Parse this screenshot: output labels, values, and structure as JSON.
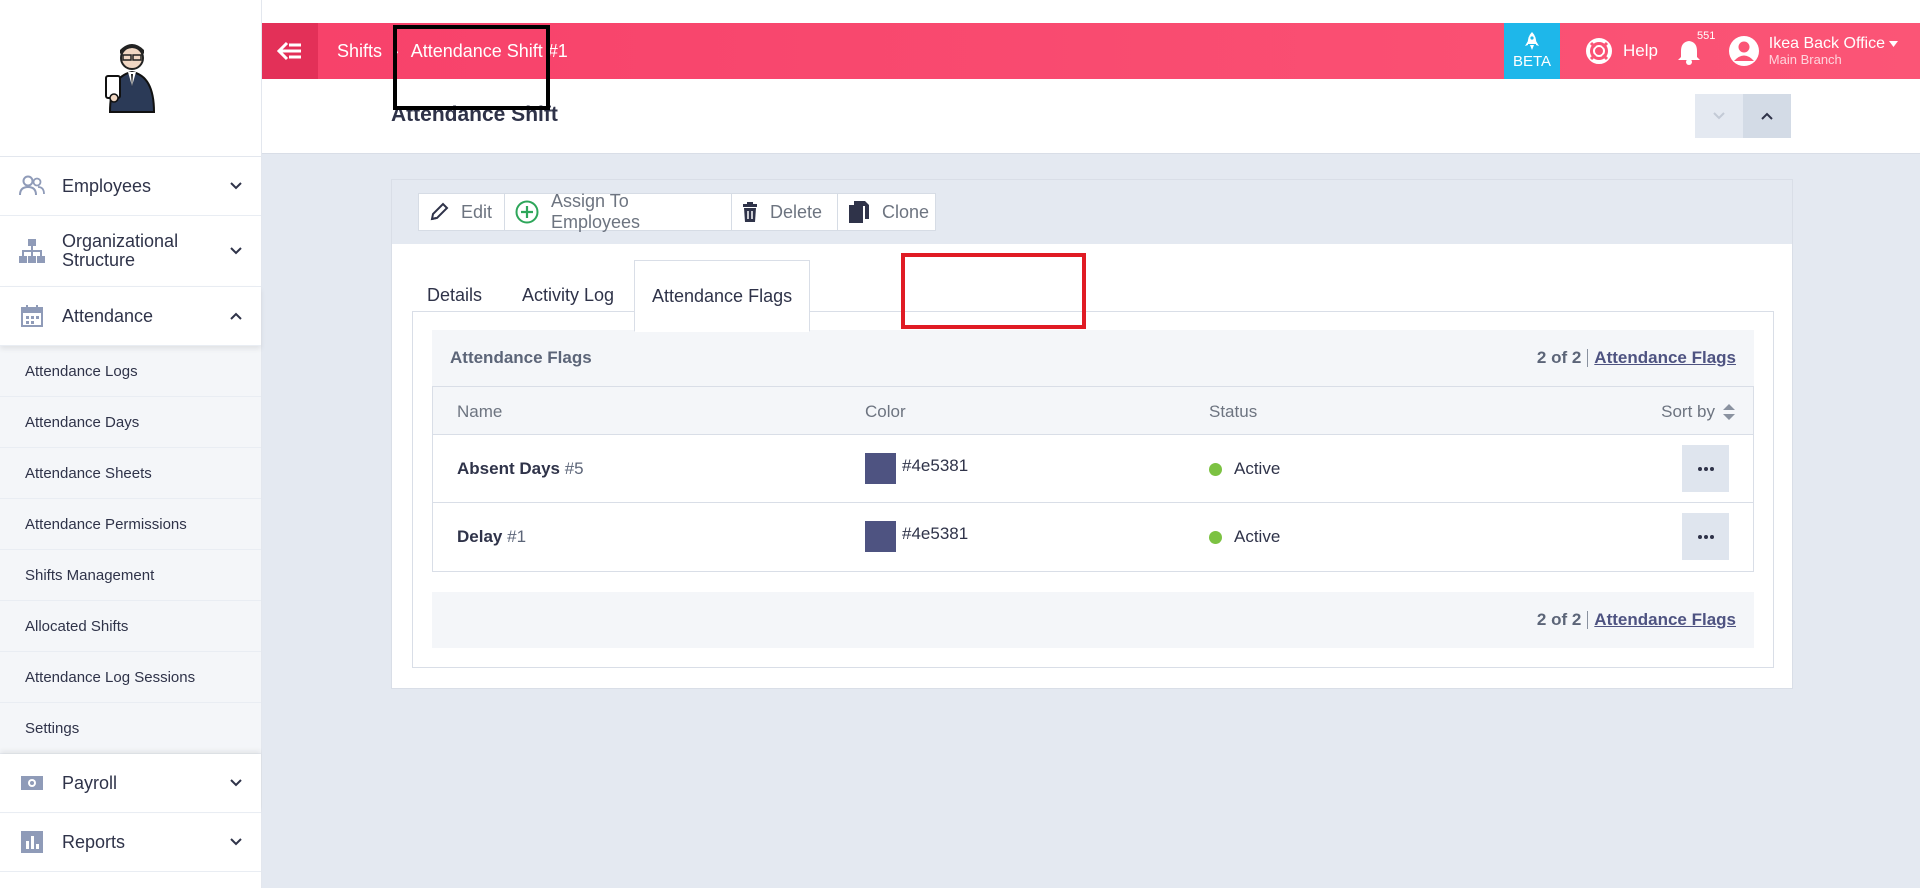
{
  "sidebar": {
    "groups": [
      {
        "label": "Employees",
        "icon": "people-icon",
        "expanded": false
      },
      {
        "label": "Organizational\nStructure",
        "icon": "org-chart-icon",
        "expanded": false
      },
      {
        "label": "Attendance",
        "icon": "calendar-icon",
        "expanded": true
      },
      {
        "label": "Payroll",
        "icon": "money-icon",
        "expanded": false
      },
      {
        "label": "Reports",
        "icon": "bar-chart-icon",
        "expanded": false
      }
    ],
    "attendance_items": [
      "Attendance Logs",
      "Attendance Days",
      "Attendance Sheets",
      "Attendance Permissions",
      "Shifts Management",
      "Allocated Shifts",
      "Attendance Log Sessions",
      "Settings"
    ],
    "icon_color": "#8f9bb8"
  },
  "topbar": {
    "crumb_parent": "Shifts",
    "crumb_current": "Attendance Shift #1",
    "beta_label": "BETA",
    "help_label": "Help",
    "notification_count": "551",
    "user_name": "Ikea Back Office",
    "user_branch": "Main Branch",
    "gradient_start": "#f7416a",
    "gradient_end": "#fb5576",
    "beta_color": "#1eb7ea"
  },
  "page": {
    "title": "Attendance Shift"
  },
  "toolbar": {
    "edit_label": "Edit",
    "assign_label": "Assign To Employees",
    "delete_label": "Delete",
    "clone_label": "Clone"
  },
  "tabs": {
    "details": "Details",
    "activity_log": "Activity Log",
    "attendance_flags": "Attendance Flags",
    "active": "attendance_flags"
  },
  "flags": {
    "title": "Attendance Flags",
    "pager_count": "2 of 2",
    "pager_link": "Attendance Flags",
    "columns": {
      "name": "Name",
      "color": "Color",
      "status": "Status",
      "sort": "Sort by"
    },
    "rows": [
      {
        "name": "Absent Days",
        "number": "#5",
        "color": "#4e5381",
        "color_text": "#4e5381",
        "status": "Active",
        "status_color": "#7cc242"
      },
      {
        "name": "Delay",
        "number": "#1",
        "color": "#4e5381",
        "color_text": "#4e5381",
        "status": "Active",
        "status_color": "#7cc242"
      }
    ]
  }
}
